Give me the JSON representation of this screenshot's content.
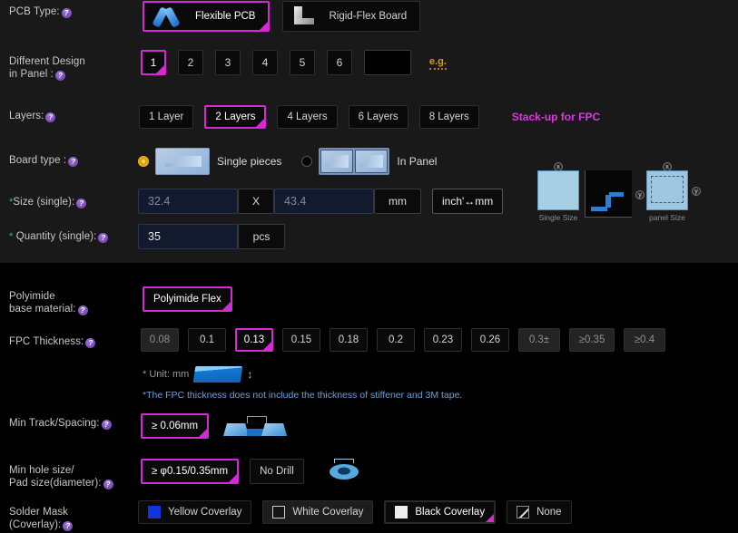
{
  "accent": "#d42ad4",
  "pcb_type": {
    "label": "PCB Type:",
    "options": [
      {
        "name": "flexible-pcb",
        "label": "Flexible PCB",
        "selected": true
      },
      {
        "name": "rigid-flex-board",
        "label": "Rigid-Flex Board",
        "selected": false
      }
    ]
  },
  "different_design": {
    "label": "Different Design\nin Panel :",
    "options": [
      "1",
      "2",
      "3",
      "4",
      "5",
      "6"
    ],
    "selected": "1",
    "custom_value": "",
    "eg_label": "e.g."
  },
  "layers": {
    "label": "Layers:",
    "options": [
      "1 Layer",
      "2 Layers",
      "4 Layers",
      "6 Layers",
      "8 Layers"
    ],
    "selected": "2 Layers",
    "link_label": "Stack-up for FPC"
  },
  "board_type": {
    "label": "Board type :",
    "options": [
      {
        "name": "single-pieces",
        "label": "Single pieces",
        "selected": true
      },
      {
        "name": "in-panel",
        "label": "In Panel",
        "selected": false
      }
    ],
    "diagrams": [
      {
        "caption": "Single Size"
      },
      {
        "caption": "panel Size"
      }
    ]
  },
  "size": {
    "label": "Size (single):",
    "required": true,
    "length_value": "32.4",
    "separator": "X",
    "width_value": "43.4",
    "unit": "mm",
    "convert_label": "inch'↔mm"
  },
  "quantity": {
    "label": "Quantity (single):",
    "required": true,
    "value": "35",
    "unit": "pcs"
  },
  "polyimide": {
    "label": "Polyimide\nbase material:",
    "options": [
      "Polyimide Flex"
    ],
    "selected": "Polyimide Flex"
  },
  "fpc_thickness": {
    "label": "FPC Thickness:",
    "options": [
      {
        "value": "0.08",
        "disabled": true
      },
      {
        "value": "0.1",
        "disabled": false
      },
      {
        "value": "0.13",
        "disabled": false
      },
      {
        "value": "0.15",
        "disabled": false
      },
      {
        "value": "0.18",
        "disabled": false
      },
      {
        "value": "0.2",
        "disabled": false
      },
      {
        "value": "0.23",
        "disabled": false
      },
      {
        "value": "0.26",
        "disabled": false
      },
      {
        "value": "0.3±",
        "disabled": true
      },
      {
        "value": "≥0.35",
        "disabled": true
      },
      {
        "value": "≥0.4",
        "disabled": true
      }
    ],
    "selected": "0.13",
    "unit_note": "* Unit: mm",
    "warning_note": "*The FPC thickness does not include the thickness of stiffener and 3M tape."
  },
  "min_track": {
    "label": "Min Track/Spacing:",
    "options": [
      "≥ 0.06mm"
    ],
    "selected": "≥ 0.06mm"
  },
  "min_hole": {
    "label": "Min hole size/\nPad size(diameter):",
    "options": [
      {
        "label": "≥ φ0.15/0.35mm",
        "selected": true
      },
      {
        "label": "No Drill",
        "selected": false
      }
    ]
  },
  "solder_mask": {
    "label": "Solder Mask\n(Coverlay):",
    "options": [
      {
        "label": "Yellow Coverlay",
        "swatch": "yellow",
        "selected": false
      },
      {
        "label": "White Coverlay",
        "swatch": "white",
        "selected": false
      },
      {
        "label": "Black Coverlay",
        "swatch": "black",
        "selected": true
      },
      {
        "label": "None",
        "swatch": "none",
        "selected": false
      }
    ]
  }
}
